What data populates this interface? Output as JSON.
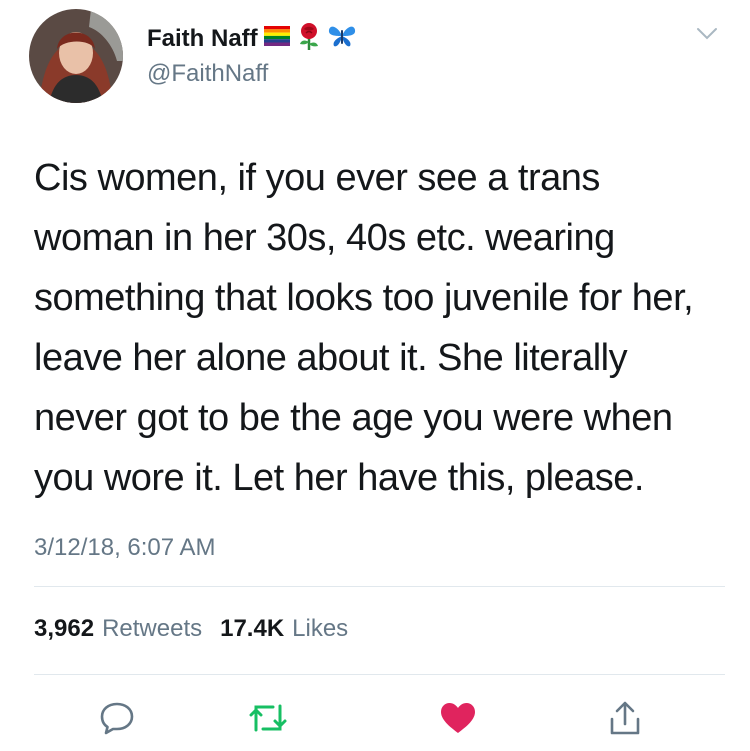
{
  "user": {
    "display_name": "Faith Naff",
    "handle": "@FaithNaff",
    "name_emojis": [
      "rainbow-flag-icon",
      "rose-icon",
      "butterfly-icon"
    ]
  },
  "tweet": {
    "lines": [
      "Cis women, if you ever see a trans",
      "woman in her 30s, 40s etc. wearing",
      "something that looks too juvenile for her,",
      "leave her alone about it. She literally",
      "never got to be the age you were when",
      "you wore it. Let her have this, please."
    ],
    "timestamp": "3/12/18, 6:07 AM"
  },
  "stats": {
    "retweets_count": "3,962",
    "retweets_label": "Retweets",
    "likes_count": "17.4K",
    "likes_label": "Likes"
  },
  "actions": [
    "reply-icon",
    "retweet-icon",
    "like-icon",
    "share-icon"
  ],
  "colors": {
    "text": "#14171a",
    "secondary": "#657786",
    "divider": "#e1e8ed",
    "retweet_green": "#17bf63",
    "like_red": "#e0245e",
    "icon_gray": "#657786"
  }
}
